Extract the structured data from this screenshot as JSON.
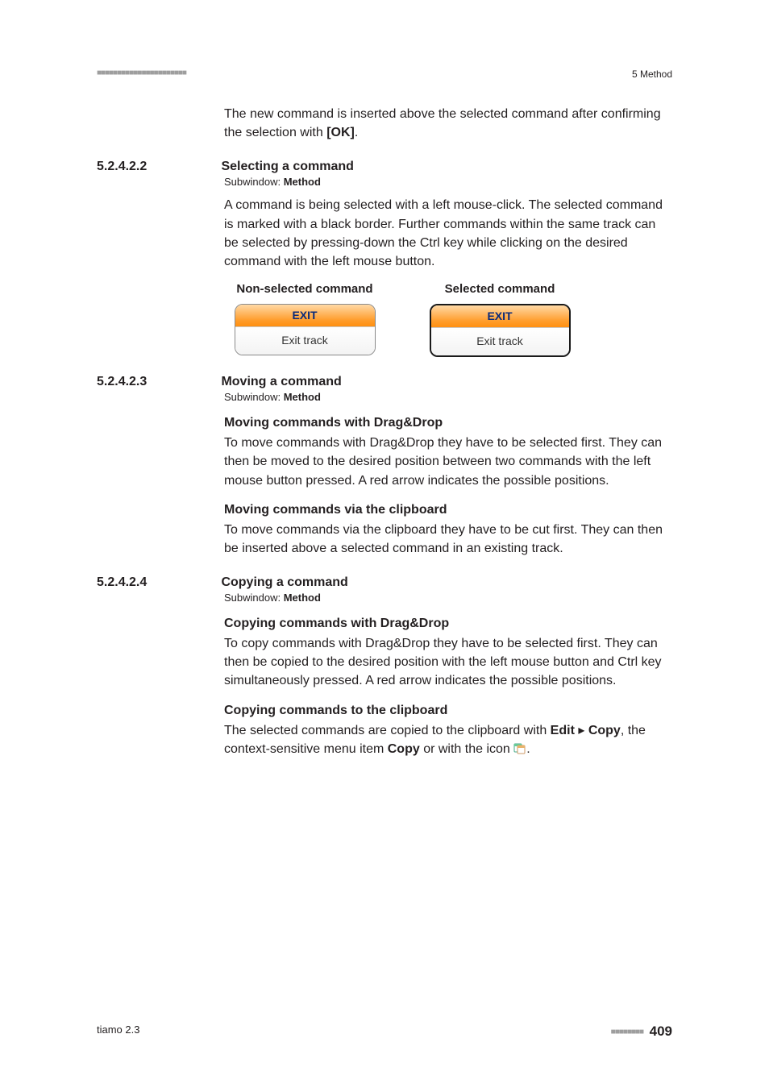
{
  "header": {
    "stripes": "■■■■■■■■■■■■■■■■■■■■■■",
    "chapter": "5 Method"
  },
  "intro": {
    "p1a": "The new command is inserted above the selected command after confirm­ing the selection with ",
    "p1b": "[OK]",
    "p1c": "."
  },
  "s1": {
    "num": "5.2.4.2.2",
    "title": "Selecting a command",
    "sub_label": "Subwindow: ",
    "sub_value": "Method",
    "p1": "A command is being selected with a left mouse-click. The selected com­mand is marked with a black border. Further commands within the same track can be selected by pressing-down the Ctrl key while clicking on the desired command with the left mouse button.",
    "col1_header": "Non-selected command",
    "col2_header": "Selected command",
    "box_top": "EXIT",
    "box_bot": "Exit track"
  },
  "s2": {
    "num": "5.2.4.2.3",
    "title": "Moving a command",
    "sub_label": "Subwindow: ",
    "sub_value": "Method",
    "h1": "Moving commands with Drag&Drop",
    "p1": "To move commands with Drag&Drop they have to be selected first. They can then be moved to the desired position between two commands with the left mouse button pressed. A red arrow indicates the possible posi­tions.",
    "h2": "Moving commands via the clipboard",
    "p2": "To move commands via the clipboard they have to be cut first. They can then be inserted above a selected command in an existing track."
  },
  "s3": {
    "num": "5.2.4.2.4",
    "title": "Copying a command",
    "sub_label": "Subwindow: ",
    "sub_value": "Method",
    "h1": "Copying commands with Drag&Drop",
    "p1": "To copy commands with Drag&Drop they have to be selected first. They can then be copied to the desired position with the left mouse button and Ctrl key simultaneously pressed. A red arrow indicates the possible posi­tions.",
    "h2": "Copying commands to the clipboard",
    "p2a": "The selected commands are copied to the clipboard with ",
    "p2b": "Edit",
    "p2c": " ▸ ",
    "p2d": "Copy",
    "p2e": ", the context-sensitive menu item ",
    "p2f": "Copy",
    "p2g": " or with the icon ",
    "p2h": "."
  },
  "footer": {
    "product": "tiamo 2.3",
    "stripes": "■■■■■■■■",
    "page": "409"
  }
}
